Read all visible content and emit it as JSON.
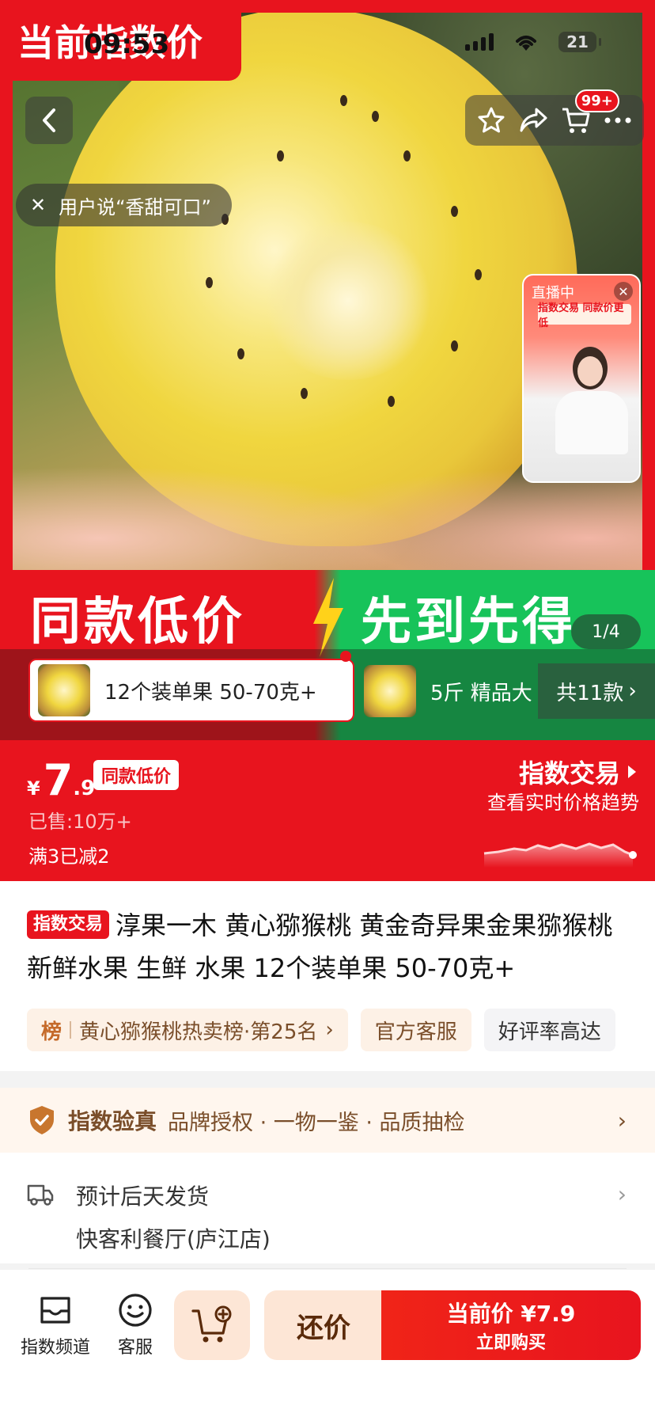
{
  "status_bar": {
    "time": "09:53",
    "battery": "21"
  },
  "hero": {
    "badge": "当前指数价",
    "cart_badge": "99+",
    "user_says": "用户说“香甜可口”",
    "live": {
      "tag": "直播中",
      "banner": "指数交易 同款价更低"
    },
    "promo_left": "同款低价",
    "promo_right": "先到先得",
    "page_indicator": "1/4"
  },
  "sku": {
    "active_label": "12个装单果 50-70克+",
    "second_label": "5斤 精品大",
    "total": "共11款"
  },
  "price": {
    "currency": "¥",
    "integer": "7",
    "decimal": ".9",
    "tag": "同款低价",
    "sold": "已售:10万+",
    "discount": "满3已减2",
    "index_title": "指数交易",
    "index_sub": "查看实时价格趋势"
  },
  "product": {
    "brand_tag": "指数交易",
    "title": "淳果一木 黄心猕猴桃 黄金奇异果金果猕猴桃 新鲜水果 生鲜 水果 12个装单果 50-70克+",
    "rank_icon": "榜",
    "rank": "黄心猕猴桃热卖榜·第25名",
    "chip_service": "官方客服",
    "chip_rating": "好评率高达"
  },
  "verify": {
    "title": "指数验真",
    "items": "品牌授权 · 一物一鉴 · 品质抽检"
  },
  "shipping": {
    "eta": "预计后天发货",
    "store": "快客利餐厅(庐江店)"
  },
  "bottom_bar": {
    "channel": "指数频道",
    "service": "客服",
    "bargain": "还价",
    "buy_price": "当前价 ¥7.9",
    "buy_now": "立即购买"
  },
  "colors": {
    "brand_red": "#e8141e",
    "promo_green": "#17c35a",
    "verify_brown": "#7a4e2a"
  }
}
